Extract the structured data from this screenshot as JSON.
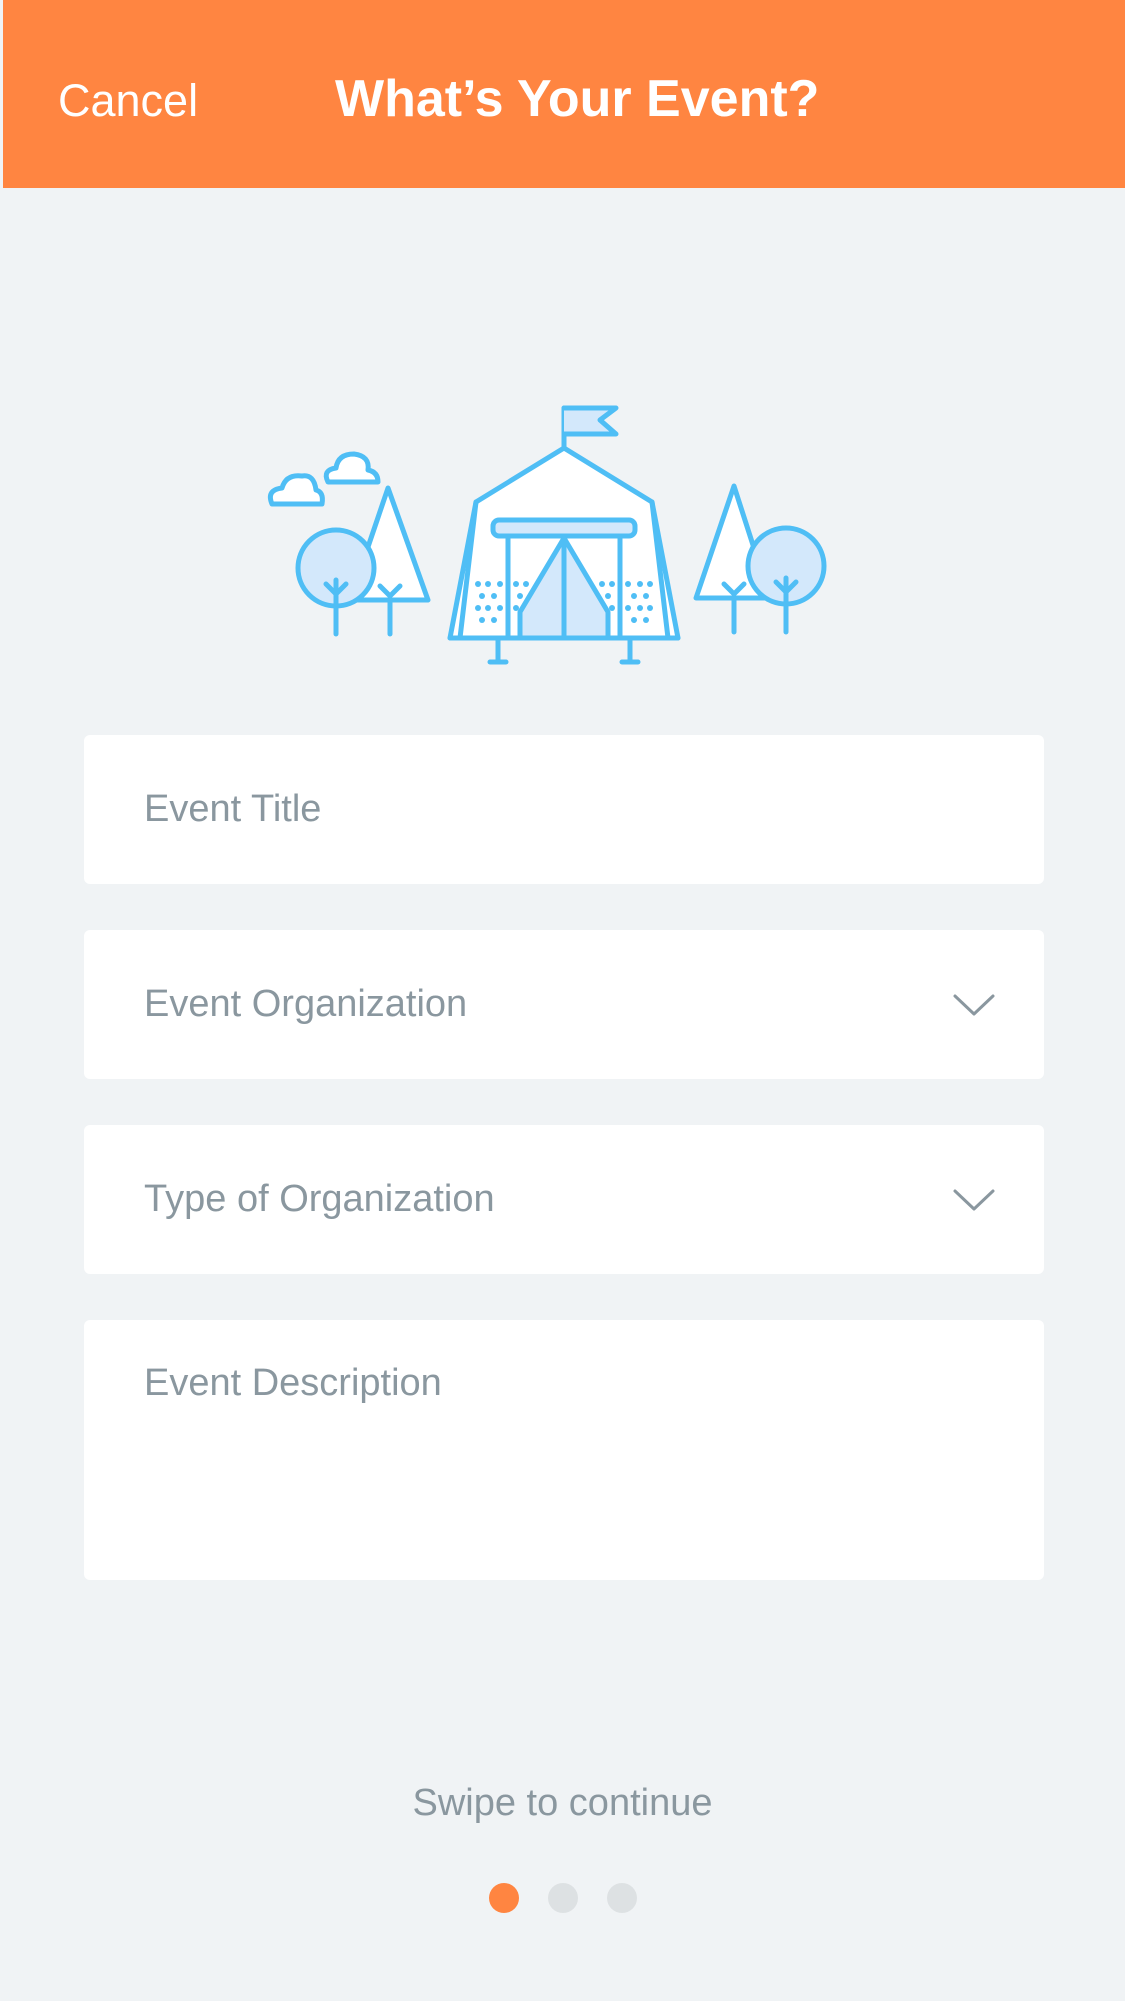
{
  "header": {
    "cancel_label": "Cancel",
    "title": "What’s Your Event?",
    "background_color": "#ff8541"
  },
  "illustration": {
    "icon": "event-tent-icon",
    "color": "#4fbef5"
  },
  "form": {
    "event_title_placeholder": "Event Title",
    "event_organization_placeholder": "Event Organization",
    "type_of_organization_placeholder": "Type of Organization",
    "event_description_placeholder": "Event Description"
  },
  "footer": {
    "swipe_label": "Swipe to continue",
    "page_count": 3,
    "current_page": 1
  }
}
